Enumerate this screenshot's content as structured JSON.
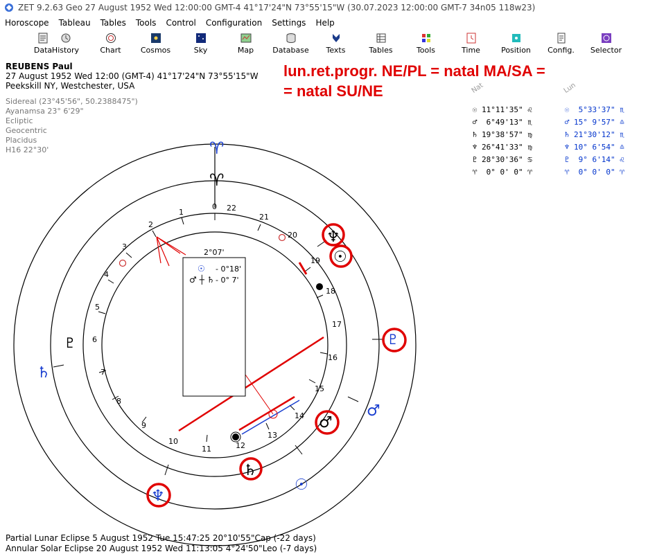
{
  "window": {
    "title": "ZET 9.2.63 Geo   27 August 1952   Wed   12:00:00 GMT-4 41°17'24\"N  73°55'15\"W   (30.07.2023   12:00:00 GMT-7 34n05 118w23)"
  },
  "menu": [
    "Horoscope",
    "Tableau",
    "Tables",
    "Tools",
    "Control",
    "Configuration",
    "Settings",
    "Help"
  ],
  "toolbar": [
    {
      "label": "Data",
      "icon": "data-icon"
    },
    {
      "label": "History",
      "icon": "history-icon"
    },
    {
      "label": "Chart",
      "icon": "chart-icon"
    },
    {
      "label": "Cosmos",
      "icon": "cosmos-icon"
    },
    {
      "label": "Sky",
      "icon": "sky-icon"
    },
    {
      "label": "Map",
      "icon": "map-icon"
    },
    {
      "label": "Database",
      "icon": "database-icon"
    },
    {
      "label": "Texts",
      "icon": "texts-icon"
    },
    {
      "label": "Tables",
      "icon": "tables-icon"
    },
    {
      "label": "Tools",
      "icon": "tools-icon"
    },
    {
      "label": "Time",
      "icon": "time-icon"
    },
    {
      "label": "Position",
      "icon": "position-icon"
    },
    {
      "label": "Config.",
      "icon": "config-icon"
    },
    {
      "label": "Selector",
      "icon": "selector-icon"
    }
  ],
  "header": {
    "name": "REUBENS Paul",
    "datetime": "27 August 1952  Wed  12:00 (GMT-4) 41°17'24\"N  73°55'15\"W",
    "place": "Peekskill NY, Westchester, USA"
  },
  "settings": [
    "Sidereal (23°45'56\", 50.2388475\")",
    "Ayanamsa 23° 6'29\"",
    "Ecliptic",
    "Geocentric",
    "Placidus",
    "H16  22°30'"
  ],
  "annotation": {
    "line1": "lun.ret.progr. NE/PL = natal MA/SA =",
    "line2": "= natal SU/NE"
  },
  "positions": {
    "nat_label": "Nat",
    "lun_label": "Lun",
    "nat": [
      {
        "sym": "☉",
        "value": "11°11'35\" ♌"
      },
      {
        "sym": "♂",
        "value": " 6°49'13\" ♏"
      },
      {
        "sym": "♄",
        "value": "19°38'57\" ♍"
      },
      {
        "sym": "♆",
        "value": "26°41'33\" ♍"
      },
      {
        "sym": "♇",
        "value": "28°30'36\" ♋"
      },
      {
        "sym": "♈",
        "value": " 0° 0' 0\" ♈"
      }
    ],
    "lun": [
      {
        "sym": "☉",
        "value": " 5°33'37\" ♏"
      },
      {
        "sym": "♂",
        "value": "15° 9'57\" ♎"
      },
      {
        "sym": "♄",
        "value": "21°30'12\" ♏"
      },
      {
        "sym": "♆",
        "value": "10° 6'54\" ♎"
      },
      {
        "sym": "♇",
        "value": " 9° 6'14\" ♌"
      },
      {
        "sym": "♈",
        "value": " 0° 0' 0\" ♈"
      }
    ]
  },
  "chart": {
    "box_title": "2°07'",
    "box_row1_sym": "☉",
    "box_row1_val": "- 0°18'",
    "box_row2_sym": "♂ ┼ ♄",
    "box_row2_val": "- 0° 7'",
    "house_numbers": [
      "0",
      "1",
      "2",
      "3",
      "4",
      "5",
      "6",
      "7",
      "8",
      "9",
      "10",
      "11",
      "12",
      "13",
      "14",
      "15",
      "16",
      "17",
      "18",
      "19",
      "20",
      "21",
      "22"
    ],
    "aries_outer": "♈",
    "aries_inner": "♈",
    "outer_symbols": {
      "neptune": "♆",
      "sun": "☉",
      "mars": "♂",
      "saturn": "♄",
      "pluto": "♇"
    },
    "inner_symbols": {
      "pluto": "♇",
      "saturn": "♄",
      "mars": "♂",
      "sun": "☉",
      "neptune": "♆"
    },
    "colors": {
      "red": "#e00000",
      "blue": "#1a3fd0",
      "black": "#000000"
    }
  },
  "footer": {
    "line1": "Partial Lunar Eclipse 5 August 1952 Tue 15:47:25 20°10'55\"Cap (-22 days)",
    "line2": "Annular Solar Eclipse 20 August 1952 Wed 11:13:05  4°24'50\"Leo (-7 days)"
  }
}
